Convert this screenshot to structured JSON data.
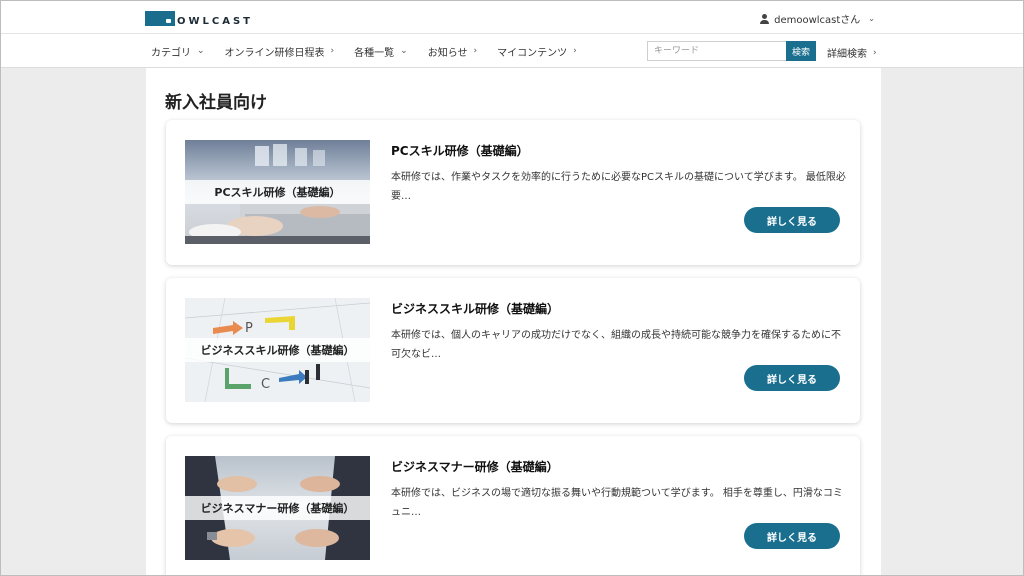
{
  "header": {
    "logo_text": "OWLCAST",
    "user_name": "demoowlcastさん"
  },
  "nav": {
    "items": [
      {
        "label": "カテゴリ",
        "arrow": "⌄"
      },
      {
        "label": "オンライン研修日程表",
        "arrow": "›"
      },
      {
        "label": "各種一覧",
        "arrow": "⌄"
      },
      {
        "label": "お知らせ",
        "arrow": "›"
      },
      {
        "label": "マイコンテンツ",
        "arrow": "›"
      }
    ],
    "search_placeholder": "キーワード",
    "search_button": "検索",
    "advanced_search": "詳細検索",
    "advanced_arrow": "›"
  },
  "page": {
    "title": "新入社員向け"
  },
  "courses": [
    {
      "thumb_label": "PCスキル研修（基礎編）",
      "title": "PCスキル研修（基礎編）",
      "desc": "本研修では、作業やタスクを効率的に行うために必要なPCスキルの基礎について学びます。 最低限必要…",
      "button": "詳しく見る"
    },
    {
      "thumb_label": "ビジネススキル研修（基礎編）",
      "title": "ビジネススキル研修（基礎編）",
      "desc": "本研修では、個人のキャリアの成功だけでなく、組織の成長や持続可能な競争力を確保するために不可欠なビ…",
      "button": "詳しく見る"
    },
    {
      "thumb_label": "ビジネスマナー研修（基礎編）",
      "title": "ビジネスマナー研修（基礎編）",
      "desc": "本研修では、ビジネスの場で適切な振る舞いや行動規範ついて学びます。 相手を尊重し、円滑なコミュニ…",
      "button": "詳しく見る"
    }
  ],
  "colors": {
    "accent": "#1a6f8f",
    "background": "#ececec"
  }
}
